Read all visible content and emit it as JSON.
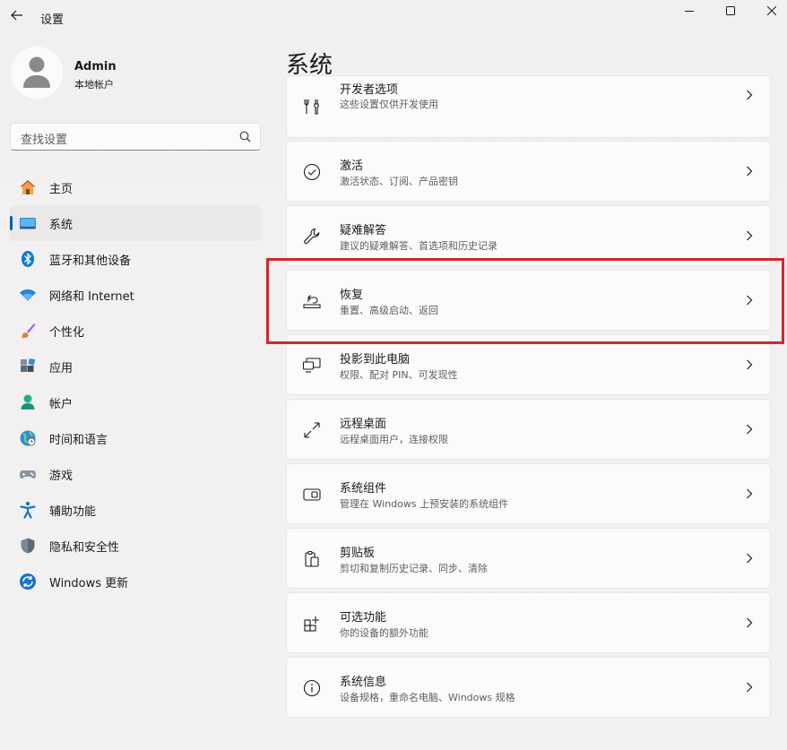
{
  "window": {
    "title": "设置"
  },
  "user": {
    "name": "Admin",
    "account_type": "本地帐户"
  },
  "search": {
    "placeholder": "查找设置"
  },
  "sidebar": {
    "items": [
      {
        "label": "主页",
        "icon": "home-icon"
      },
      {
        "label": "系统",
        "icon": "system-icon",
        "selected": true
      },
      {
        "label": "蓝牙和其他设备",
        "icon": "bluetooth-icon"
      },
      {
        "label": "网络和 Internet",
        "icon": "wifi-icon"
      },
      {
        "label": "个性化",
        "icon": "brush-icon"
      },
      {
        "label": "应用",
        "icon": "apps-icon"
      },
      {
        "label": "帐户",
        "icon": "person-icon"
      },
      {
        "label": "时间和语言",
        "icon": "globe-icon"
      },
      {
        "label": "游戏",
        "icon": "gamepad-icon"
      },
      {
        "label": "辅助功能",
        "icon": "accessibility-icon"
      },
      {
        "label": "隐私和安全性",
        "icon": "shield-icon"
      },
      {
        "label": "Windows 更新",
        "icon": "update-icon"
      }
    ]
  },
  "main": {
    "title": "系统",
    "cards": [
      {
        "title": "开发者选项",
        "desc": "这些设置仅供开发使用",
        "icon": "developer-tools-icon"
      },
      {
        "title": "激活",
        "desc": "激活状态、订阅、产品密钥",
        "icon": "checkmark-circle-icon"
      },
      {
        "title": "疑难解答",
        "desc": "建议的疑难解答、首选项和历史记录",
        "icon": "wrench-icon"
      },
      {
        "title": "恢复",
        "desc": "重置、高级启动、返回",
        "icon": "recovery-icon"
      },
      {
        "title": "投影到此电脑",
        "desc": "权限、配对 PIN、可发现性",
        "icon": "projection-icon"
      },
      {
        "title": "远程桌面",
        "desc": "远程桌面用户，连接权限",
        "icon": "remote-desktop-icon"
      },
      {
        "title": "系统组件",
        "desc": "管理在 Windows 上预安装的系统组件",
        "icon": "system-components-icon"
      },
      {
        "title": "剪贴板",
        "desc": "剪切和复制历史记录、同步、清除",
        "icon": "clipboard-icon"
      },
      {
        "title": "可选功能",
        "desc": "你的设备的额外功能",
        "icon": "optional-features-icon"
      },
      {
        "title": "系统信息",
        "desc": "设备规格，重命名电脑、Windows 规格",
        "icon": "info-icon"
      }
    ]
  },
  "colors": {
    "accent": "#005fb8",
    "highlight": "#d6252b"
  }
}
